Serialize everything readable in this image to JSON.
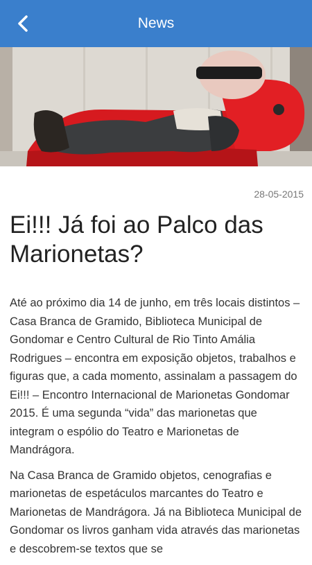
{
  "header": {
    "title": "News",
    "back_icon": "chevron-left-icon"
  },
  "article": {
    "date": "28-05-2015",
    "title": "Ei!!! Já foi ao Palco das Marionetas?",
    "paragraphs": [
      "Até ao próximo dia 14 de junho, em três locais distintos – Casa Branca de Gramido, Biblioteca Municipal de Gondomar e Centro Cultural de Rio Tinto Amália Rodrigues – encontra em exposição objetos, trabalhos e figuras que, a cada momento, assinalam a passagem do Ei!!! – Encontro Internacional de Marionetas Gondomar 2015. É uma segunda “vida” das marionetas que integram o espólio do Teatro e Marionetas de Mandrágora.",
      "Na Casa Branca de Gramido objetos, cenografias e marionetas de espetáculos marcantes do Teatro e Marionetas de Mandrágora. Já na Biblioteca Municipal de Gondomar os livros ganham vida através das marionetas e descobrem-se textos que se"
    ]
  },
  "colors": {
    "appbar": "#3a7fcc",
    "sofa": "#d61a1f"
  }
}
